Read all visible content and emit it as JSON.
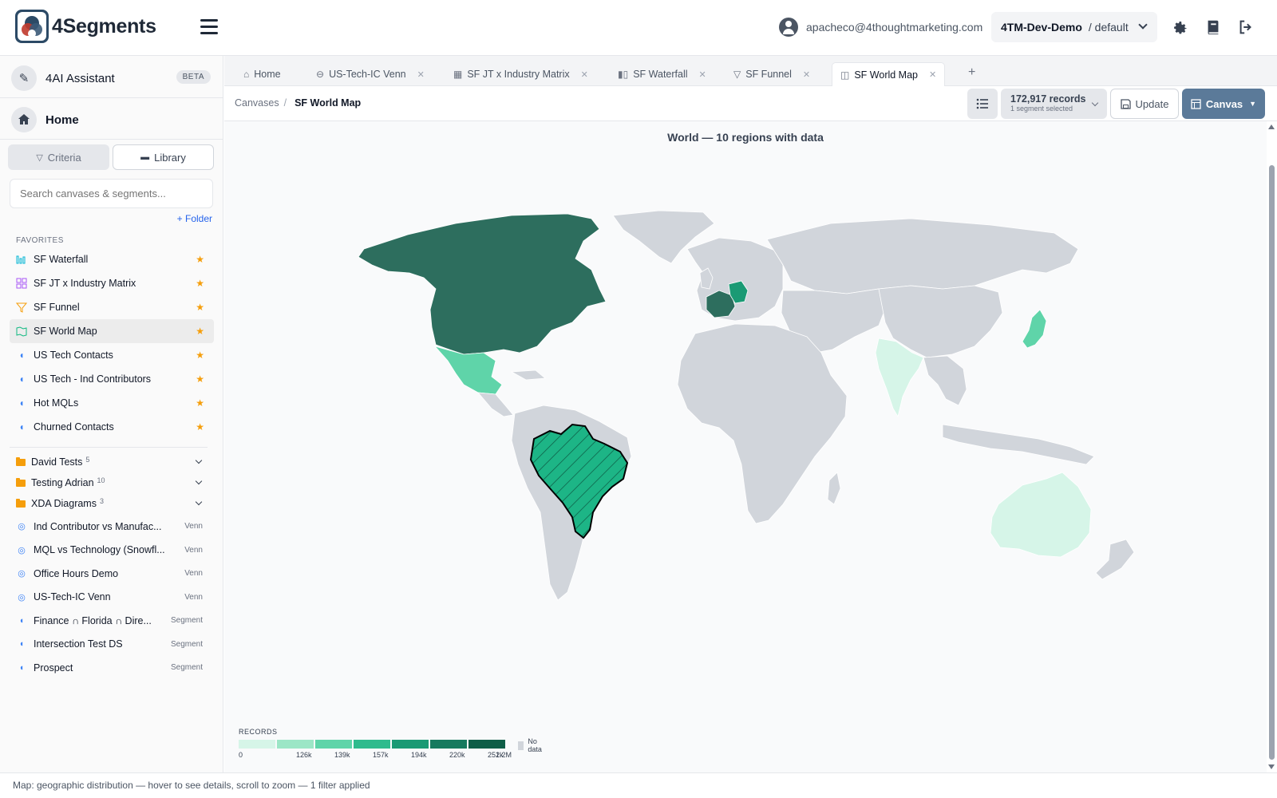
{
  "app": {
    "logo_text": "4Segments"
  },
  "header": {
    "user_email": "apacheco@4thoughtmarketing.com",
    "org_name": "4TM-Dev-Demo",
    "org_sub": "/ default"
  },
  "sidebar": {
    "ai_label": "4AI Assistant",
    "ai_badge": "BETA",
    "home_label": "Home",
    "tab_criteria": "Criteria",
    "tab_library": "Library",
    "search_placeholder": "Search canvases & segments...",
    "add_folder": "+ Folder",
    "favorites_heading": "FAVORITES",
    "favorites": [
      {
        "label": "SF Waterfall",
        "icon": "waterfall-icon"
      },
      {
        "label": "SF JT x Industry Matrix",
        "icon": "matrix-icon"
      },
      {
        "label": "SF Funnel",
        "icon": "funnel-icon"
      },
      {
        "label": "SF World Map",
        "icon": "map-icon"
      },
      {
        "label": "US Tech Contacts",
        "icon": "segment-icon"
      },
      {
        "label": "US Tech - Ind Contributors",
        "icon": "segment-icon"
      },
      {
        "label": "Hot MQLs",
        "icon": "segment-icon"
      },
      {
        "label": "Churned Contacts",
        "icon": "segment-icon"
      }
    ],
    "folders": [
      {
        "label": "David Tests",
        "count": "5"
      },
      {
        "label": "Testing Adrian",
        "count": "10"
      },
      {
        "label": "XDA Diagrams",
        "count": "3"
      }
    ],
    "items": [
      {
        "label": "Ind Contributor vs Manufac...",
        "tag": "Venn"
      },
      {
        "label": "MQL vs Technology (Snowfl...",
        "tag": "Venn"
      },
      {
        "label": "Office Hours Demo",
        "tag": "Venn"
      },
      {
        "label": "US-Tech-IC Venn",
        "tag": "Venn"
      },
      {
        "label": "Finance ∩ Florida ∩ Dire...",
        "tag": "Segment"
      },
      {
        "label": "Intersection Test DS",
        "tag": "Segment"
      },
      {
        "label": "Prospect",
        "tag": "Segment"
      }
    ]
  },
  "tabs": [
    {
      "label": "Home",
      "closable": false
    },
    {
      "label": "US-Tech-IC Venn",
      "closable": true
    },
    {
      "label": "SF JT x Industry Matrix",
      "closable": true
    },
    {
      "label": "SF Waterfall",
      "closable": true
    },
    {
      "label": "SF Funnel",
      "closable": true
    },
    {
      "label": "SF World Map",
      "closable": true,
      "active": true
    }
  ],
  "toolbar": {
    "crumb_root": "Canvases",
    "crumb_current": "SF World Map",
    "records_count": "172,917 records",
    "records_sub": "1 segment selected",
    "update_label": "Update",
    "canvas_label": "Canvas"
  },
  "map": {
    "title": "World — 10 regions with data",
    "legend_title": "RECORDS",
    "legend_ticks": [
      "0",
      "126k",
      "139k",
      "157k",
      "194k",
      "220k",
      "252k",
      "1.2M"
    ],
    "legend_colors": [
      "#d6f5e8",
      "#9ce6c6",
      "#5fd4a9",
      "#2fbb8d",
      "#1a9a74",
      "#167a5e",
      "#0e5e47"
    ],
    "no_data_label": "No data",
    "no_data_color": "#d1d5db"
  },
  "status_text": "Map: geographic distribution — hover to see details, scroll to zoom — 1 filter applied"
}
